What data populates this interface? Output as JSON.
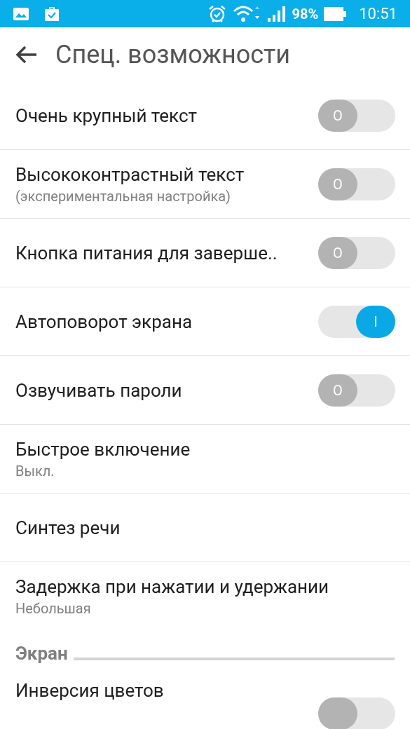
{
  "status_bar": {
    "battery": "98%",
    "time": "10:51"
  },
  "header": {
    "title": "Спец. возможности"
  },
  "items": [
    {
      "kind": "switch",
      "title": "Очень крупный текст",
      "on": false,
      "knob": "O"
    },
    {
      "kind": "switch",
      "title": "Высококонтрастный текст",
      "subtitle": "(экспериментальная настройка)",
      "on": false,
      "knob": "O"
    },
    {
      "kind": "switch",
      "title": "Кнопка питания для заверше..",
      "on": false,
      "knob": "O"
    },
    {
      "kind": "switch",
      "title": "Автоповорот экрана",
      "on": true,
      "knob": "I"
    },
    {
      "kind": "switch",
      "title": "Озвучивать пароли",
      "on": false,
      "knob": "O"
    },
    {
      "kind": "plain",
      "title": "Быстрое включение",
      "subtitle": "Выкл."
    },
    {
      "kind": "plain",
      "title": "Синтез речи"
    },
    {
      "kind": "plain",
      "title": "Задержка при нажатии и удержании",
      "subtitle": "Небольшая"
    }
  ],
  "section": {
    "title": "Экран"
  },
  "section_items": [
    {
      "kind": "switch",
      "title": "Инверсия цветов",
      "on": false
    }
  ]
}
